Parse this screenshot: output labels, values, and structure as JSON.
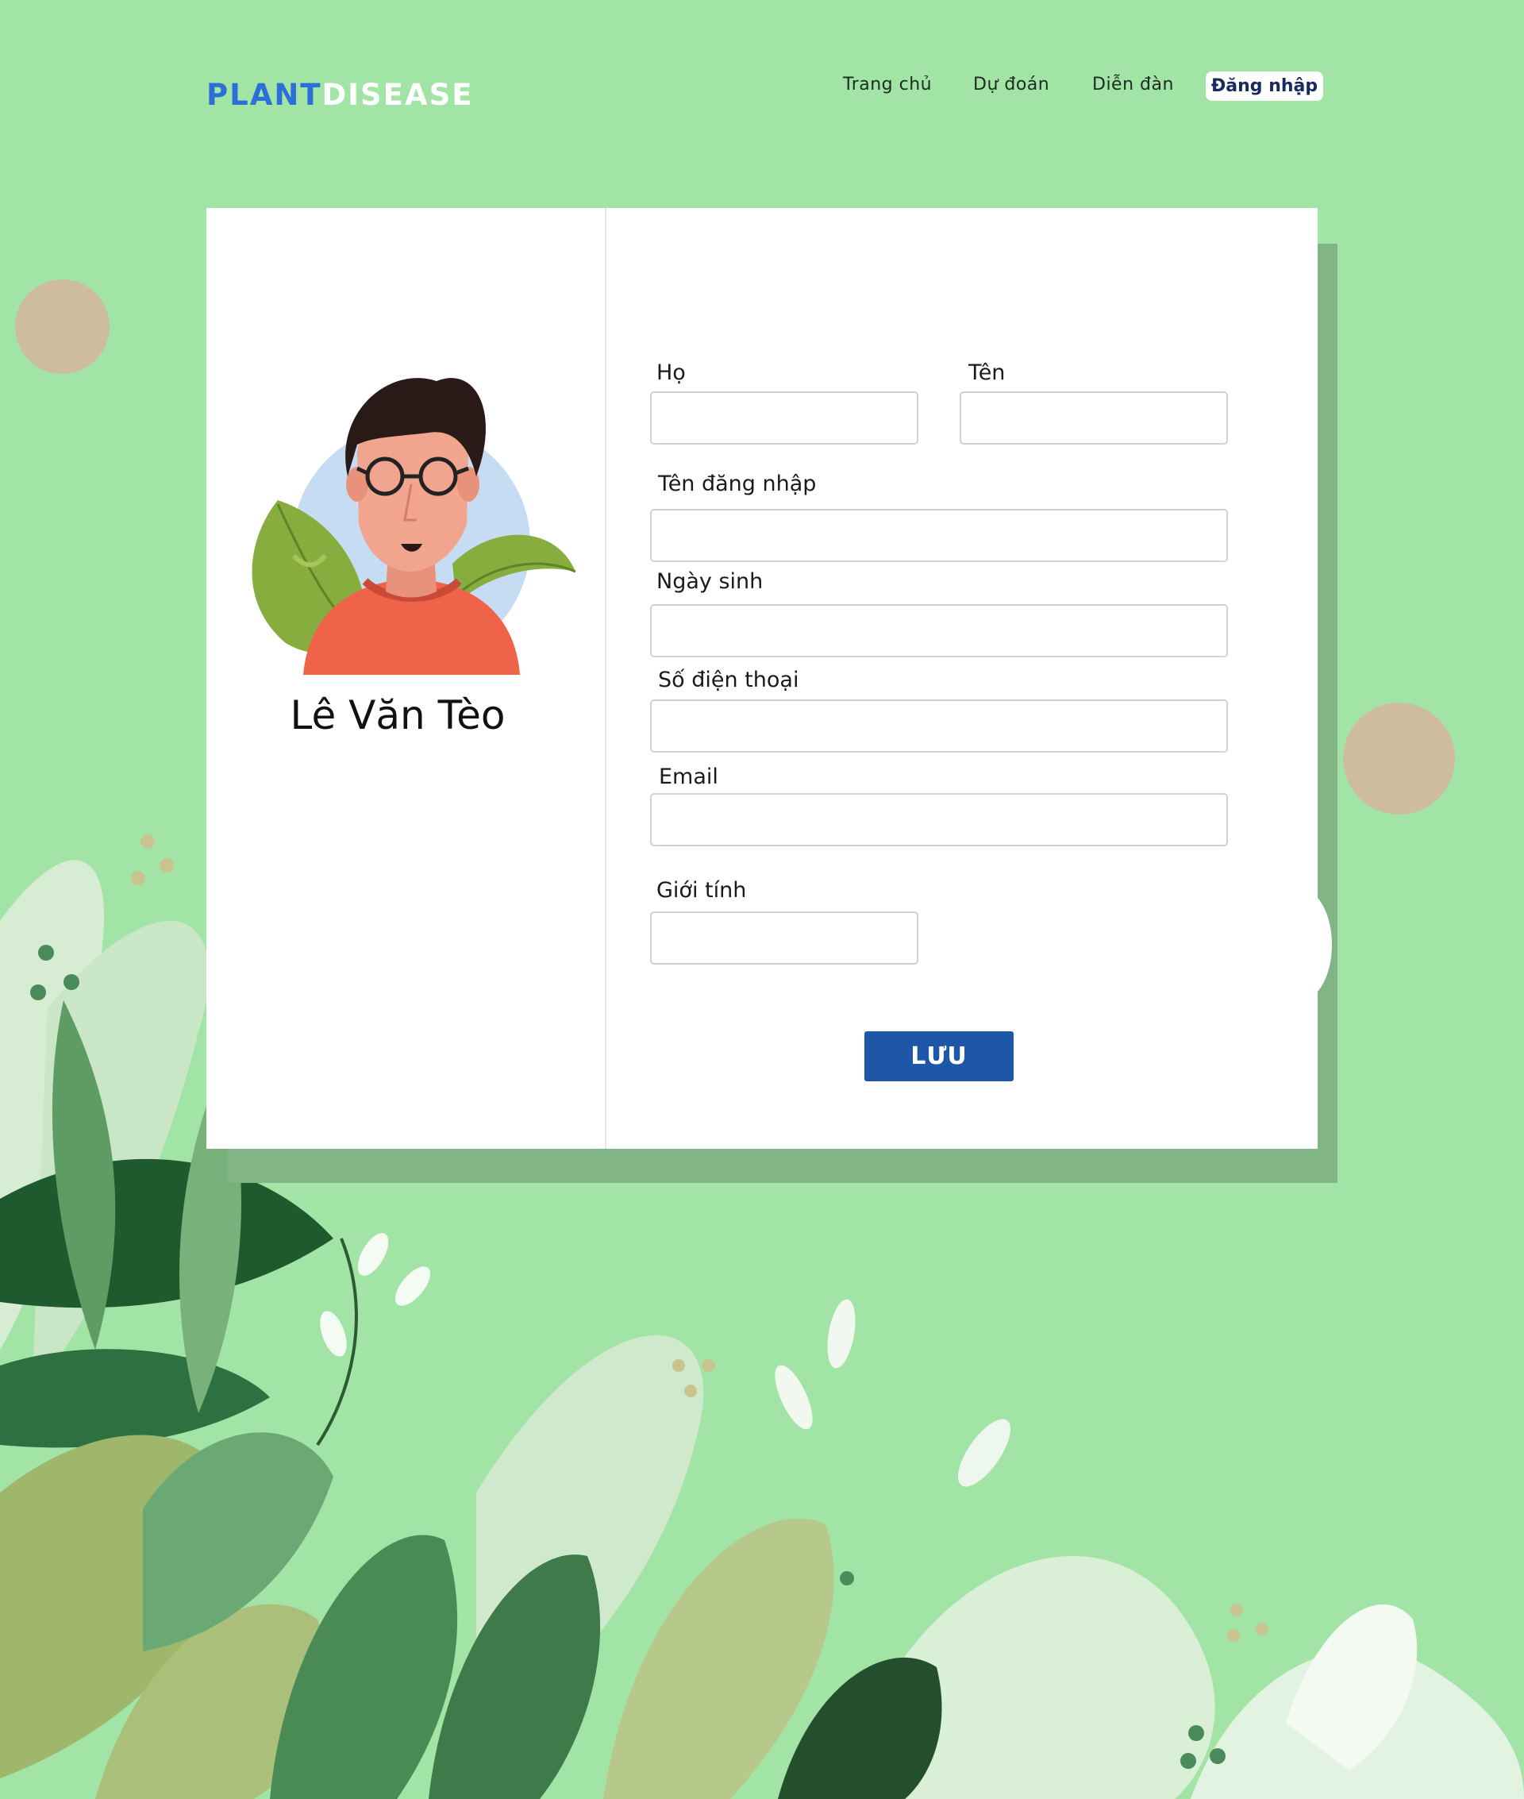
{
  "header": {
    "logo_part1": "PLANT",
    "logo_part2": "DISEASE",
    "nav": [
      {
        "label": "Trang chủ"
      },
      {
        "label": "Dự đoán"
      },
      {
        "label": "Diễn đàn"
      }
    ],
    "login_label": "Đăng nhập"
  },
  "profile": {
    "name": "Lê Văn Tèo"
  },
  "form": {
    "last_name": {
      "label": "Họ",
      "value": ""
    },
    "first_name": {
      "label": "Tên",
      "value": ""
    },
    "username": {
      "label": "Tên đăng nhập",
      "value": ""
    },
    "birthday": {
      "label": "Ngày sinh",
      "value": ""
    },
    "phone": {
      "label": "Số điện thoại",
      "value": ""
    },
    "email": {
      "label": "Email",
      "value": ""
    },
    "gender": {
      "label": "Giới tính",
      "value": ""
    },
    "save_label": "LƯU"
  },
  "colors": {
    "background": "#a2e4a6",
    "logo_blue": "#2d6fd8",
    "button_blue": "#1f57a8",
    "decor_circle": "#cdbc9e"
  }
}
